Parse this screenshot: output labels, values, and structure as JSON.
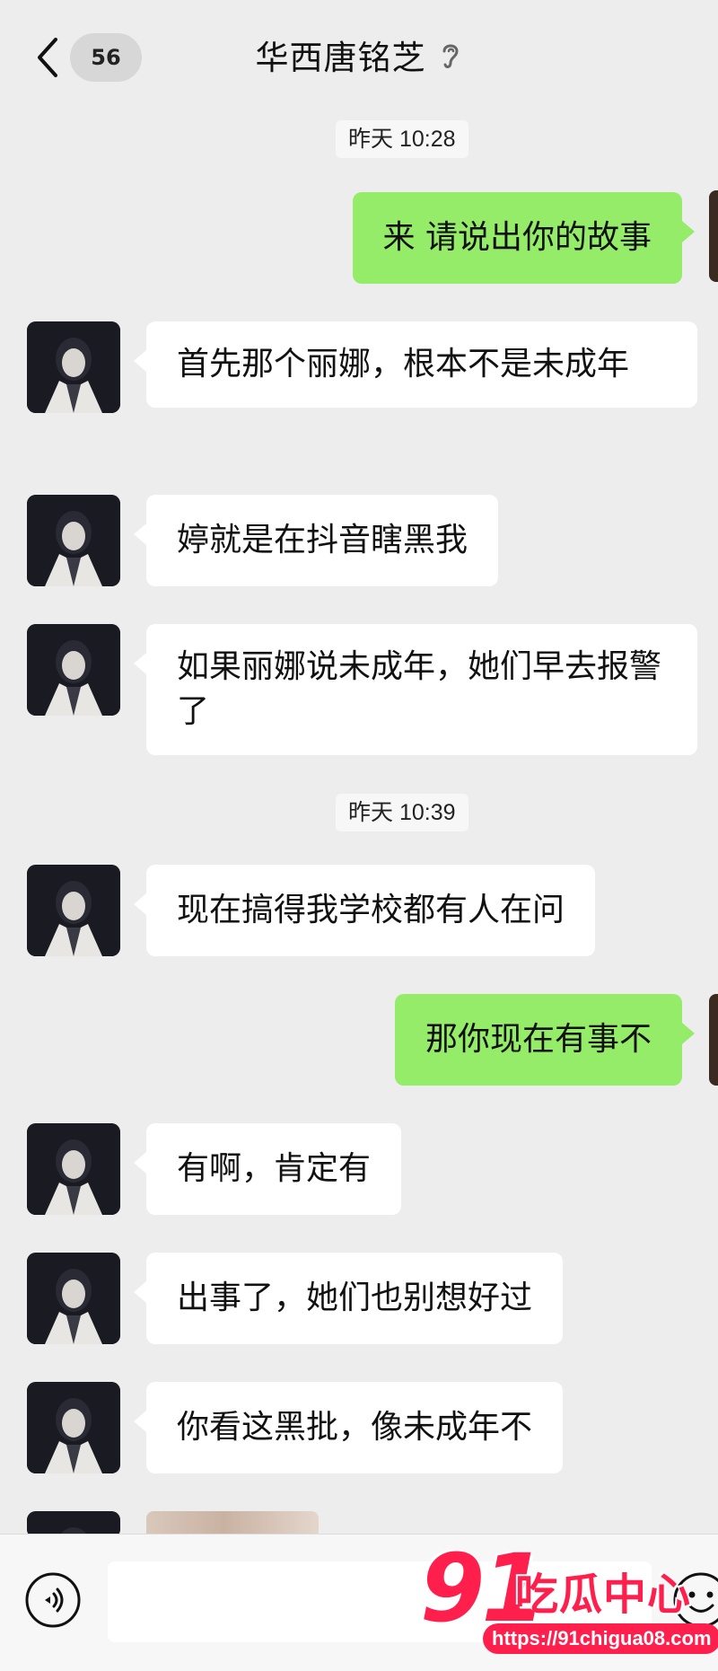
{
  "header": {
    "unread_count": "56",
    "title": "华西唐铭芝",
    "icons": {
      "back": "chevron-left-icon",
      "mode": "ear-icon"
    }
  },
  "timestamps": [
    "昨天 10:28",
    "昨天 10:39"
  ],
  "messages": [
    {
      "side": "out",
      "text": "来 请说出你的故事"
    },
    {
      "side": "in",
      "text": "首先那个丽娜，根本不是未成年"
    },
    {
      "side": "in",
      "text": "婷就是在抖音瞎黑我"
    },
    {
      "side": "in",
      "text": "如果丽娜说未成年，她们早去报警了"
    },
    {
      "side": "in",
      "text": "现在搞得我学校都有人在问"
    },
    {
      "side": "out",
      "text": "那你现在有事不"
    },
    {
      "side": "in",
      "text": "有啊，肯定有"
    },
    {
      "side": "in",
      "text": "出事了，她们也别想好过"
    },
    {
      "side": "in",
      "text": "你看这黑批，像未成年不"
    }
  ],
  "footer": {
    "icons": {
      "voice": "voice-icon",
      "emoji": "emoji-icon"
    }
  },
  "watermark": {
    "number": "91",
    "text": "吃瓜中心",
    "url": "https://91chigua08.com"
  },
  "colors": {
    "background": "#ededed",
    "incoming_bubble": "#ffffff",
    "outgoing_bubble": "#95ec69",
    "watermark": "#ff1f4d"
  }
}
